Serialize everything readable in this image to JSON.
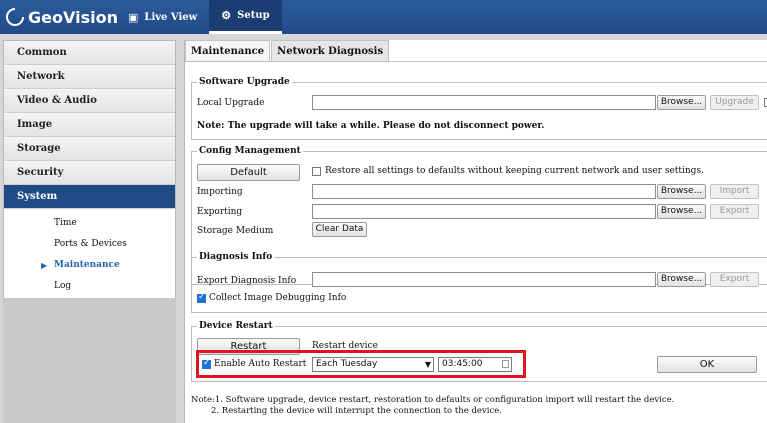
{
  "brand": "GeoVision",
  "topnav": {
    "live_view": "Live View",
    "setup": "Setup"
  },
  "sidebar": {
    "items": [
      "Common",
      "Network",
      "Video & Audio",
      "Image",
      "Storage",
      "Security",
      "System"
    ],
    "sub_items": [
      "Time",
      "Ports & Devices",
      "Maintenance",
      "Log"
    ]
  },
  "tabs": [
    "Maintenance",
    "Network Diagnosis"
  ],
  "software_upgrade": {
    "legend": "Software Upgrade",
    "local_upgrade_label": "Local Upgrade",
    "browse": "Browse...",
    "upgrade": "Upgrade",
    "note": "Note: The upgrade will take a while. Please do not disconnect power."
  },
  "config": {
    "legend": "Config Management",
    "default_btn": "Default",
    "restore_label": "Restore all settings to defaults without keeping current network and user settings.",
    "importing": "Importing",
    "exporting": "Exporting",
    "storage_medium": "Storage Medium",
    "browse": "Browse...",
    "import": "Import",
    "export": "Export",
    "clear_data": "Clear Data"
  },
  "diagnosis": {
    "legend": "Diagnosis Info",
    "export_label": "Export Diagnosis Info",
    "browse": "Browse...",
    "export": "Export",
    "collect_label": "Collect Image Debugging Info"
  },
  "restart": {
    "legend": "Device Restart",
    "restart_btn": "Restart",
    "restart_text": "Restart device",
    "auto_label": "Enable Auto Restart",
    "schedule": "Each Tuesday",
    "time": "03:45:00",
    "ok": "OK"
  },
  "notes": {
    "line1": "Note:1. Software upgrade, device restart, restoration to defaults or configuration import will restart the device.",
    "line2": "2. Restarting the device will interrupt the connection to the device."
  },
  "colors": {
    "header": "#2c5b9c",
    "active_sidebar": "#1f4a86",
    "highlight": "#e0141f"
  }
}
